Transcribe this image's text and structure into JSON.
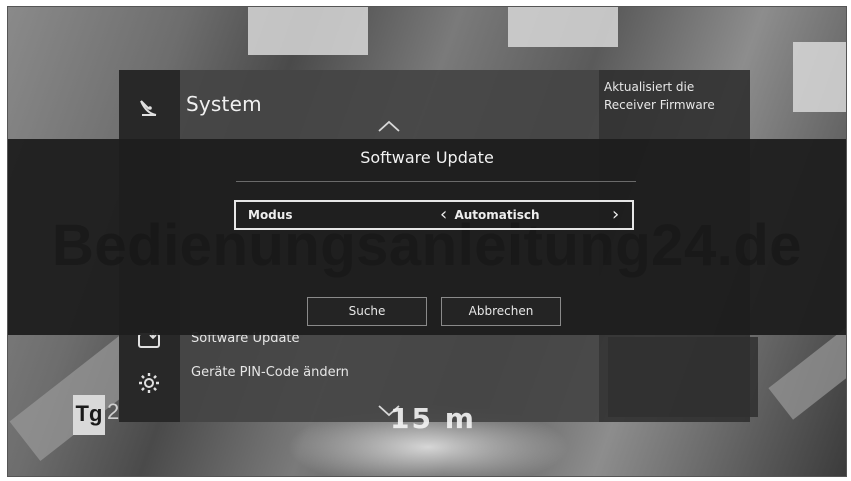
{
  "menu": {
    "title": "System",
    "items": [
      {
        "label": "Software Update"
      },
      {
        "label": "Geräte PIN-Code ändern"
      }
    ]
  },
  "description": {
    "text": "Aktualisiert die Receiver Firmware"
  },
  "dialog": {
    "title": "Software Update",
    "setting": {
      "label": "Modus",
      "value": "Automatisch"
    },
    "buttons": {
      "search": "Suche",
      "cancel": "Abbrechen"
    }
  },
  "watermark": "Bedienungsanleitung24.de",
  "channel_logo": {
    "text": "Tg",
    "suffix": "2"
  },
  "overlay_text": "15 m",
  "icons": {
    "satellite": "satellite-dish-icon",
    "gear": "gear-icon",
    "device": "device-update-icon",
    "chevron_up": "chevron-up-icon",
    "chevron_down": "chevron-down-icon"
  },
  "colors": {
    "dialog_bg": "#1e1e1e",
    "panel_bg": "#444444",
    "highlight_border": "#e6e6e6"
  }
}
